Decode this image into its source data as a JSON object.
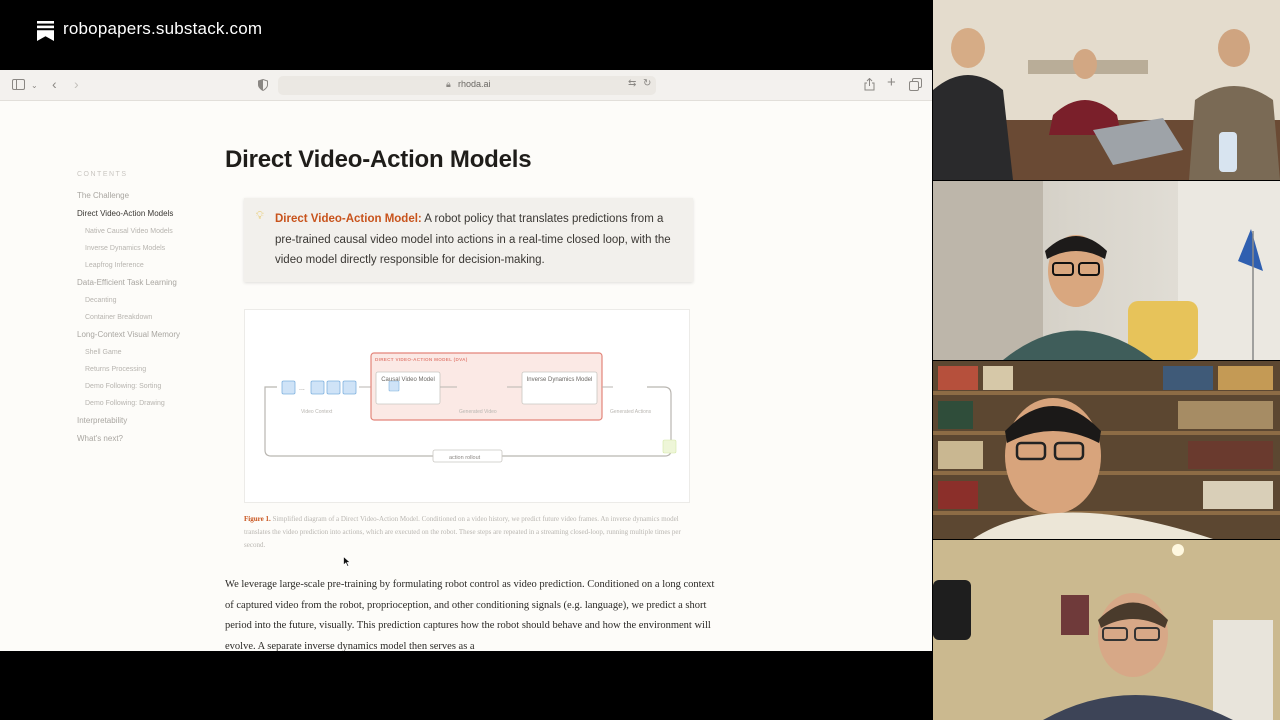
{
  "banner": {
    "site": "robopapers.substack.com"
  },
  "browser": {
    "url": "rhoda.ai",
    "icons": [
      "sidebar-icon",
      "chevron-down-icon",
      "back-icon",
      "forward-icon",
      "shield-icon",
      "lock-icon",
      "translate-icon",
      "reload-icon",
      "share-icon",
      "plus-icon",
      "tabs-icon"
    ]
  },
  "toc": {
    "header": "CONTENTS",
    "items": [
      {
        "label": "The Challenge",
        "level": 1
      },
      {
        "label": "Direct Video-Action Models",
        "level": 1,
        "active": true
      },
      {
        "label": "Native Causal Video Models",
        "level": 2
      },
      {
        "label": "Inverse Dynamics Models",
        "level": 2
      },
      {
        "label": "Leapfrog Inference",
        "level": 2
      },
      {
        "label": "Data-Efficient Task Learning",
        "level": 1
      },
      {
        "label": "Decanting",
        "level": 2
      },
      {
        "label": "Container Breakdown",
        "level": 2
      },
      {
        "label": "Long-Context Visual Memory",
        "level": 1
      },
      {
        "label": "Shell Game",
        "level": 2
      },
      {
        "label": "Returns Processing",
        "level": 2
      },
      {
        "label": "Demo Following: Sorting",
        "level": 2
      },
      {
        "label": "Demo Following: Drawing",
        "level": 2
      },
      {
        "label": "Interpretability",
        "level": 1
      },
      {
        "label": "What's next?",
        "level": 1
      }
    ]
  },
  "article": {
    "title": "Direct Video-Action Models",
    "callout": {
      "term": "Direct Video-Action Model:",
      "text": " A robot policy that translates predictions from a pre-trained causal video model into actions in a real-time closed loop, with the video model directly responsible for decision-making."
    },
    "diagram": {
      "group_label": "DIRECT VIDEO-ACTION MODEL (DVA)",
      "video_context": "Video Context",
      "causal_box": "Causal Video Model",
      "generated_video": "Generated Video",
      "inverse_box": "Inverse Dynamics Model",
      "generated_actions": "Generated Actions",
      "rollout": "action rollout",
      "ellipsis": "..."
    },
    "caption": {
      "label": "Figure 1.",
      "text": " Simplified diagram of a Direct Video-Action Model. Conditioned on a video history, we predict future video frames. An inverse dynamics model translates the video prediction into actions, which are executed on the robot. These steps are repeated in a streaming closed-loop, running multiple times per second."
    },
    "body": "We leverage large-scale pre-training by formulating robot control as video prediction. Conditioned on a long context of captured video from the robot, proprioception, and other conditioning signals (e.g. language), we predict a short period into the future, visually. This prediction captures how the robot should behave and how the environment will evolve. A separate inverse dynamics model then serves as a"
  },
  "colors": {
    "accent": "#c8531c",
    "callout_bg": "#f2f0ec",
    "dva_border": "#e3857a",
    "dva_fill": "#fbe9e5",
    "frame_fill": "#cfe3f7"
  },
  "participants": [
    "video-tile-1",
    "video-tile-2",
    "video-tile-3",
    "video-tile-4"
  ]
}
